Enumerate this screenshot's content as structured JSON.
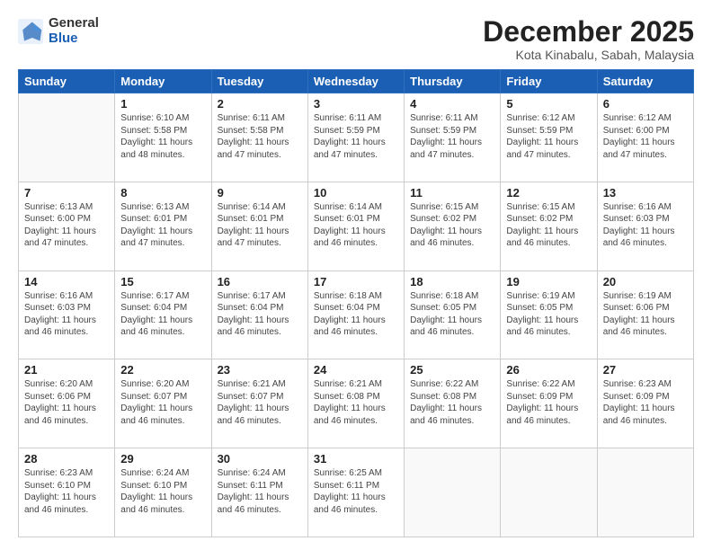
{
  "logo": {
    "general": "General",
    "blue": "Blue"
  },
  "title": "December 2025",
  "location": "Kota Kinabalu, Sabah, Malaysia",
  "days_header": [
    "Sunday",
    "Monday",
    "Tuesday",
    "Wednesday",
    "Thursday",
    "Friday",
    "Saturday"
  ],
  "weeks": [
    [
      {
        "day": "",
        "info": ""
      },
      {
        "day": "1",
        "info": "Sunrise: 6:10 AM\nSunset: 5:58 PM\nDaylight: 11 hours\nand 48 minutes."
      },
      {
        "day": "2",
        "info": "Sunrise: 6:11 AM\nSunset: 5:58 PM\nDaylight: 11 hours\nand 47 minutes."
      },
      {
        "day": "3",
        "info": "Sunrise: 6:11 AM\nSunset: 5:59 PM\nDaylight: 11 hours\nand 47 minutes."
      },
      {
        "day": "4",
        "info": "Sunrise: 6:11 AM\nSunset: 5:59 PM\nDaylight: 11 hours\nand 47 minutes."
      },
      {
        "day": "5",
        "info": "Sunrise: 6:12 AM\nSunset: 5:59 PM\nDaylight: 11 hours\nand 47 minutes."
      },
      {
        "day": "6",
        "info": "Sunrise: 6:12 AM\nSunset: 6:00 PM\nDaylight: 11 hours\nand 47 minutes."
      }
    ],
    [
      {
        "day": "7",
        "info": "Sunrise: 6:13 AM\nSunset: 6:00 PM\nDaylight: 11 hours\nand 47 minutes."
      },
      {
        "day": "8",
        "info": "Sunrise: 6:13 AM\nSunset: 6:01 PM\nDaylight: 11 hours\nand 47 minutes."
      },
      {
        "day": "9",
        "info": "Sunrise: 6:14 AM\nSunset: 6:01 PM\nDaylight: 11 hours\nand 47 minutes."
      },
      {
        "day": "10",
        "info": "Sunrise: 6:14 AM\nSunset: 6:01 PM\nDaylight: 11 hours\nand 46 minutes."
      },
      {
        "day": "11",
        "info": "Sunrise: 6:15 AM\nSunset: 6:02 PM\nDaylight: 11 hours\nand 46 minutes."
      },
      {
        "day": "12",
        "info": "Sunrise: 6:15 AM\nSunset: 6:02 PM\nDaylight: 11 hours\nand 46 minutes."
      },
      {
        "day": "13",
        "info": "Sunrise: 6:16 AM\nSunset: 6:03 PM\nDaylight: 11 hours\nand 46 minutes."
      }
    ],
    [
      {
        "day": "14",
        "info": "Sunrise: 6:16 AM\nSunset: 6:03 PM\nDaylight: 11 hours\nand 46 minutes."
      },
      {
        "day": "15",
        "info": "Sunrise: 6:17 AM\nSunset: 6:04 PM\nDaylight: 11 hours\nand 46 minutes."
      },
      {
        "day": "16",
        "info": "Sunrise: 6:17 AM\nSunset: 6:04 PM\nDaylight: 11 hours\nand 46 minutes."
      },
      {
        "day": "17",
        "info": "Sunrise: 6:18 AM\nSunset: 6:04 PM\nDaylight: 11 hours\nand 46 minutes."
      },
      {
        "day": "18",
        "info": "Sunrise: 6:18 AM\nSunset: 6:05 PM\nDaylight: 11 hours\nand 46 minutes."
      },
      {
        "day": "19",
        "info": "Sunrise: 6:19 AM\nSunset: 6:05 PM\nDaylight: 11 hours\nand 46 minutes."
      },
      {
        "day": "20",
        "info": "Sunrise: 6:19 AM\nSunset: 6:06 PM\nDaylight: 11 hours\nand 46 minutes."
      }
    ],
    [
      {
        "day": "21",
        "info": "Sunrise: 6:20 AM\nSunset: 6:06 PM\nDaylight: 11 hours\nand 46 minutes."
      },
      {
        "day": "22",
        "info": "Sunrise: 6:20 AM\nSunset: 6:07 PM\nDaylight: 11 hours\nand 46 minutes."
      },
      {
        "day": "23",
        "info": "Sunrise: 6:21 AM\nSunset: 6:07 PM\nDaylight: 11 hours\nand 46 minutes."
      },
      {
        "day": "24",
        "info": "Sunrise: 6:21 AM\nSunset: 6:08 PM\nDaylight: 11 hours\nand 46 minutes."
      },
      {
        "day": "25",
        "info": "Sunrise: 6:22 AM\nSunset: 6:08 PM\nDaylight: 11 hours\nand 46 minutes."
      },
      {
        "day": "26",
        "info": "Sunrise: 6:22 AM\nSunset: 6:09 PM\nDaylight: 11 hours\nand 46 minutes."
      },
      {
        "day": "27",
        "info": "Sunrise: 6:23 AM\nSunset: 6:09 PM\nDaylight: 11 hours\nand 46 minutes."
      }
    ],
    [
      {
        "day": "28",
        "info": "Sunrise: 6:23 AM\nSunset: 6:10 PM\nDaylight: 11 hours\nand 46 minutes."
      },
      {
        "day": "29",
        "info": "Sunrise: 6:24 AM\nSunset: 6:10 PM\nDaylight: 11 hours\nand 46 minutes."
      },
      {
        "day": "30",
        "info": "Sunrise: 6:24 AM\nSunset: 6:11 PM\nDaylight: 11 hours\nand 46 minutes."
      },
      {
        "day": "31",
        "info": "Sunrise: 6:25 AM\nSunset: 6:11 PM\nDaylight: 11 hours\nand 46 minutes."
      },
      {
        "day": "",
        "info": ""
      },
      {
        "day": "",
        "info": ""
      },
      {
        "day": "",
        "info": ""
      }
    ]
  ]
}
